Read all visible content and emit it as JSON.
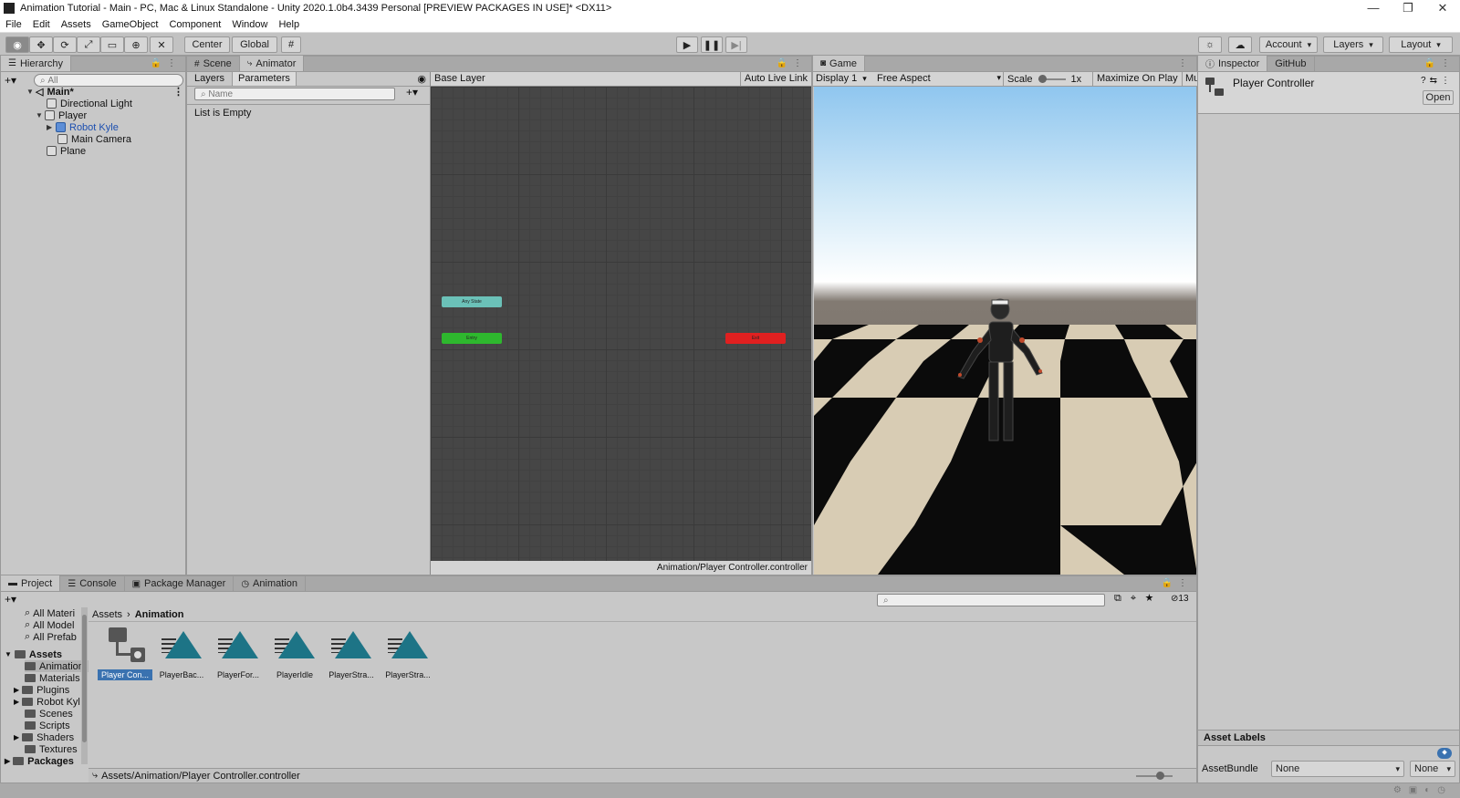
{
  "window": {
    "title": "Animation Tutorial - Main - PC, Mac & Linux Standalone - Unity 2020.1.0b4.3439 Personal [PREVIEW PACKAGES IN USE]* <DX11>",
    "controls": [
      "—",
      "❐",
      "✕"
    ]
  },
  "menu": [
    "File",
    "Edit",
    "Assets",
    "GameObject",
    "Component",
    "Window",
    "Help"
  ],
  "toolbar": {
    "center": "Center",
    "global": "Global",
    "account": "Account",
    "layers": "Layers",
    "layout": "Layout"
  },
  "hierarchy": {
    "tab": "Hierarchy",
    "search_placeholder": "All",
    "items": [
      "Main*",
      "Directional Light",
      "Player",
      "Robot Kyle",
      "Main Camera",
      "Plane"
    ]
  },
  "animator": {
    "tabs": [
      "Scene",
      "Animator"
    ],
    "subtabs": [
      "Layers",
      "Parameters"
    ],
    "name_placeholder": "Name",
    "empty_text": "List is Empty",
    "breadcrumb": "Base Layer",
    "auto_live_link": "Auto Live Link",
    "nodes": {
      "any_state": "Any State",
      "entry": "Entry",
      "exit": "Exit"
    },
    "path": "Animation/Player Controller.controller"
  },
  "game": {
    "tab": "Game",
    "display": "Display 1",
    "aspect": "Free Aspect",
    "scale_label": "Scale",
    "scale_value": "1x",
    "maximize": "Maximize On Play",
    "mute": "Mute"
  },
  "inspector": {
    "tabs": [
      "Inspector",
      "GitHub"
    ],
    "object_name": "Player Controller",
    "open_button": "Open",
    "asset_labels": "Asset Labels",
    "asset_bundle_label": "AssetBundle",
    "asset_bundle_value": "None",
    "asset_bundle_variant": "None"
  },
  "project": {
    "tabs": [
      "Project",
      "Console",
      "Package Manager",
      "Animation"
    ],
    "hidden_count": "13",
    "breadcrumb": [
      "Assets",
      "Animation"
    ],
    "favorites": [
      "All Materi",
      "All Model",
      "All Prefab"
    ],
    "tree": [
      "Assets",
      "Animation",
      "Materials",
      "Plugins",
      "Robot Kyl",
      "Scenes",
      "Scripts",
      "Shaders",
      "Textures",
      "Packages"
    ],
    "assets": [
      "Player Con...",
      "PlayerBac...",
      "PlayerFor...",
      "PlayerIdle",
      "PlayerStra...",
      "PlayerStra..."
    ],
    "path": "Assets/Animation/Player Controller.controller"
  },
  "colors": {
    "any_state": "#6bc1b8",
    "entry": "#2eb82e",
    "exit": "#e02020",
    "selection": "#3a72b0",
    "anim_clip": "#1d7486"
  }
}
